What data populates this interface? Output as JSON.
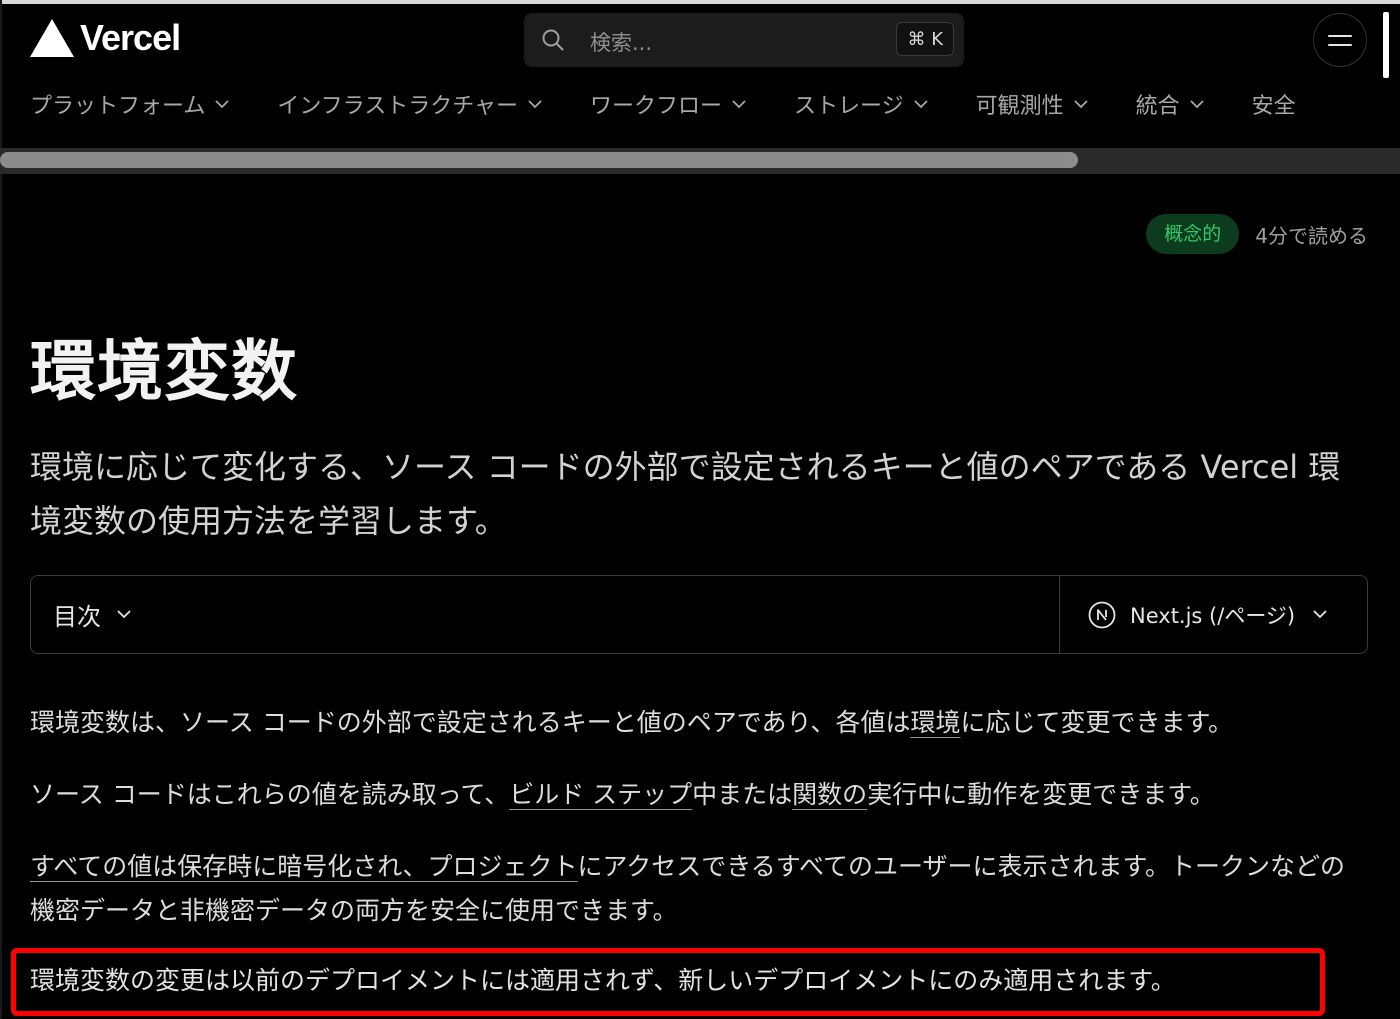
{
  "header": {
    "logo_text": "Vercel",
    "search_placeholder": "検索...",
    "search_shortcut": "⌘ K"
  },
  "nav": {
    "items": [
      {
        "label": "プラットフォーム"
      },
      {
        "label": "インフラストラクチャー"
      },
      {
        "label": "ワークフロー"
      },
      {
        "label": "ストレージ"
      },
      {
        "label": "可観測性"
      },
      {
        "label": "統合"
      },
      {
        "label": "安全"
      }
    ]
  },
  "scrollbar": {
    "thumb_fraction": 0.77
  },
  "meta": {
    "badge": "概念的",
    "read_time": "4分で読める"
  },
  "page": {
    "title": "環境変数",
    "lead": "環境に応じて変化する、ソース コードの外部で設定されるキーと値のペアである Vercel 環境変数の使用方法を学習します。"
  },
  "toolbar": {
    "toc_label": "目次",
    "framework_label": "Next.js (/ページ)"
  },
  "content": {
    "p1": {
      "before": "環境変数は、ソース コードの外部で設定されるキーと値のペアであり、各値は",
      "link": "環境",
      "after": "に応じて変更できます。"
    },
    "p2": {
      "before": "ソース コードはこれらの値を読み取って、",
      "link1": "ビルド ステップ",
      "middle": "中または",
      "link2": "関数の",
      "after": "実行中に動作を変更できます。"
    },
    "p3": {
      "link": "すべての値は保存時に暗号化され、プロジェクト",
      "after": "にアクセスできるすべてのユーザーに表示されます。トークンなどの機密データと非機密データの両方を安全に使用できます。"
    },
    "p4": "環境変数の変更は以前のデプロイメントには適用されず、新しいデプロイメントにのみ適用されます。"
  },
  "colors": {
    "background": "#000000",
    "badge_bg": "#0d3b1e",
    "badge_text": "#34c768",
    "highlight_border": "#ff0000"
  }
}
